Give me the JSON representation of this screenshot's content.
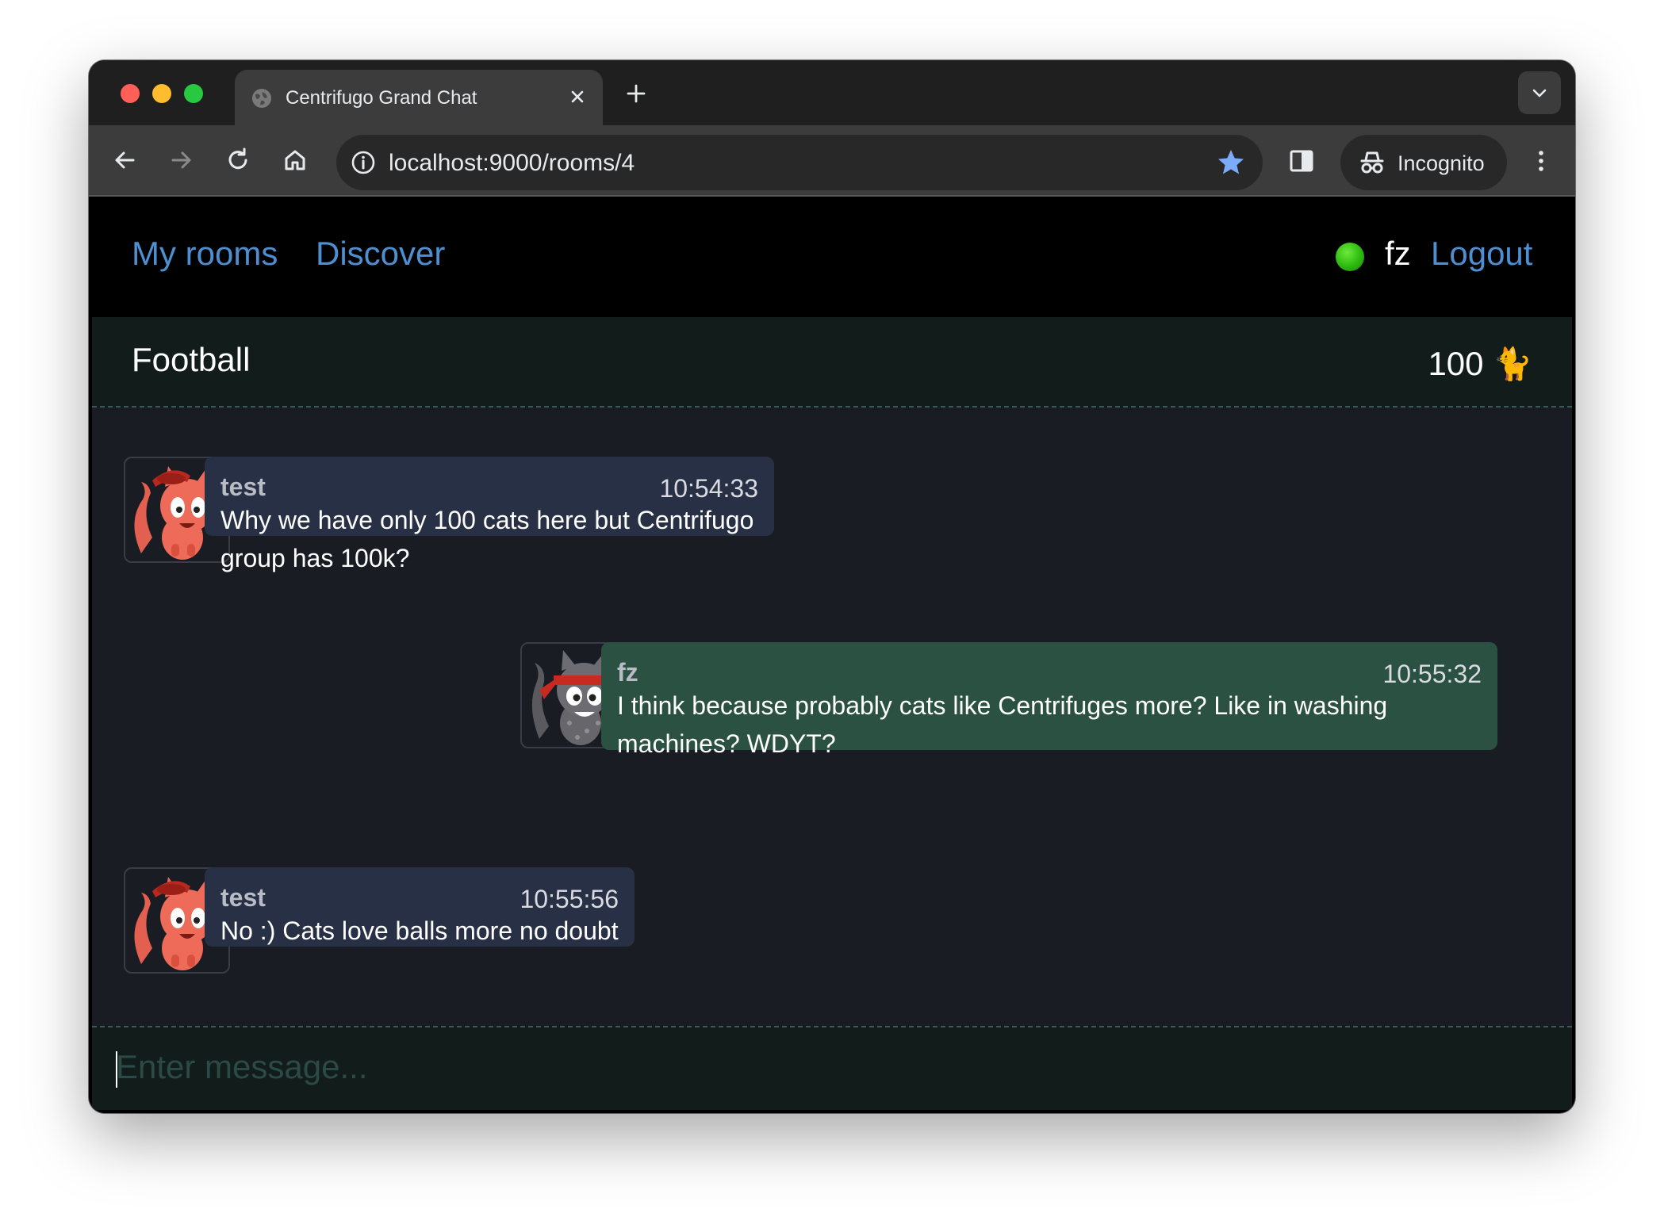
{
  "browser": {
    "tab_title": "Centrifugo Grand Chat",
    "url": "localhost:9000/rooms/4",
    "incognito_label": "Incognito"
  },
  "nav": {
    "my_rooms": "My rooms",
    "discover": "Discover",
    "username": "fz",
    "logout": "Logout",
    "status_color": "#2db90f"
  },
  "room": {
    "name": "Football",
    "member_count": "100",
    "member_icon": "🐈"
  },
  "messages": [
    {
      "sender": "test",
      "time": "10:54:33",
      "text": "Why we have only 100 cats here but Centrifugo group has 100k?",
      "mine": false
    },
    {
      "sender": "fz",
      "time": "10:55:32",
      "text_line1": "I think because probably cats like Centrifuges more? Like in washing",
      "text_line2": "machines? WDYT?",
      "mine": true
    },
    {
      "sender": "test",
      "time": "10:55:56",
      "text": "No :) Cats love balls more no doubt",
      "mine": false
    }
  ],
  "composer": {
    "placeholder": "Enter message..."
  },
  "colors": {
    "link": "#4d8fd1",
    "bubble_other": "#283046",
    "bubble_mine": "#2b5143",
    "room_header_bg": "#111c1b",
    "messages_bg": "#1a1c24"
  }
}
